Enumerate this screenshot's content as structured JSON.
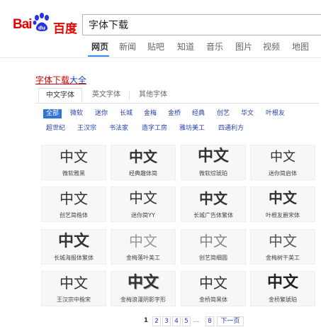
{
  "header": {
    "logo_bai": "Bai",
    "logo_du": "百度",
    "search_value": "字体下载"
  },
  "nav": {
    "items": [
      "网页",
      "新闻",
      "贴吧",
      "知道",
      "音乐",
      "图片",
      "视频",
      "地图"
    ],
    "active": "网页"
  },
  "result": {
    "title_part1": "字体下载",
    "title_part2": "大全",
    "tabs": [
      "中文字体",
      "英文字体",
      "其他字体"
    ],
    "filters_row1": [
      "全部",
      "微软",
      "迷你",
      "长城",
      "金梅",
      "金桥",
      "经典",
      "创艺",
      "华文",
      "叶根友"
    ],
    "filters_row2": [
      "超世纪",
      "王汉宗",
      "书法家",
      "造字工房",
      "雅坊美工",
      "四通利方"
    ],
    "selected_filter": "全部",
    "fonts": [
      {
        "sample": "中文",
        "name": "微软雅黑"
      },
      {
        "sample": "中文",
        "name": "经典趣体简"
      },
      {
        "sample": "中文",
        "name": "微软综琥珀"
      },
      {
        "sample": "中文",
        "name": "迷你简启体"
      },
      {
        "sample": "中文",
        "name": "创艺简楷体"
      },
      {
        "sample": "中文",
        "name": "迷你简YY"
      },
      {
        "sample": "中文",
        "name": "长城广告体繁体"
      },
      {
        "sample": "中文",
        "name": "叶根友爵宋体"
      },
      {
        "sample": "中文",
        "name": "长城海报体繁体"
      },
      {
        "sample": "中文",
        "name": "金梅落叶美工"
      },
      {
        "sample": "中文",
        "name": "创艺简细圆"
      },
      {
        "sample": "中文",
        "name": "金梅树干美工"
      },
      {
        "sample": "中文",
        "name": "王汉宗中楷宋"
      },
      {
        "sample": "中文",
        "name": "金梅浪漫阴影字形"
      },
      {
        "sample": "中文",
        "name": "金桥简黑体"
      },
      {
        "sample": "中文",
        "name": "金桥繁琥珀"
      }
    ]
  },
  "pagination": {
    "pages": [
      "1",
      "2",
      "3",
      "4",
      "5",
      "...",
      "8"
    ],
    "current": "1",
    "next": "下一页"
  },
  "colors": {
    "brand_red": "#e10602",
    "paw_blue": "#2932e1",
    "link_blue": "#2440b3",
    "filter_selected_bg": "#2e75d8"
  }
}
